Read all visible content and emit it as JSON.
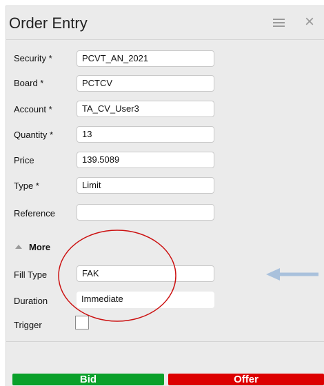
{
  "window": {
    "title": "Order Entry",
    "menu_icon": "hamburger-menu-icon",
    "close_icon": "close-icon"
  },
  "form": {
    "fields": [
      {
        "label": "Security *",
        "value": "PCVT_AN_2021"
      },
      {
        "label": "Board *",
        "value": "PCTCV"
      },
      {
        "label": "Account *",
        "value": "TA_CV_User3"
      },
      {
        "label": "Quantity *",
        "value": "13"
      },
      {
        "label": "Price",
        "value": "139.5089"
      },
      {
        "label": "Type *",
        "value": "Limit"
      },
      {
        "label": "Reference",
        "value": ""
      }
    ],
    "more_label": "More",
    "more_icon": "triangle-up-icon",
    "extra": [
      {
        "label": "Fill Type",
        "value": "FAK"
      },
      {
        "label": "Duration",
        "value": "Immediate"
      }
    ],
    "trigger": {
      "label": "Trigger",
      "checked": false
    }
  },
  "buttons": {
    "bid": "Bid",
    "offer": "Offer",
    "bid_color": "#0aa02a",
    "offer_color": "#dc0000"
  },
  "annotations": {
    "circle_color": "#cc1111",
    "arrow_color": "#a9c1dc",
    "arrow_icon": "left-arrow-icon"
  }
}
